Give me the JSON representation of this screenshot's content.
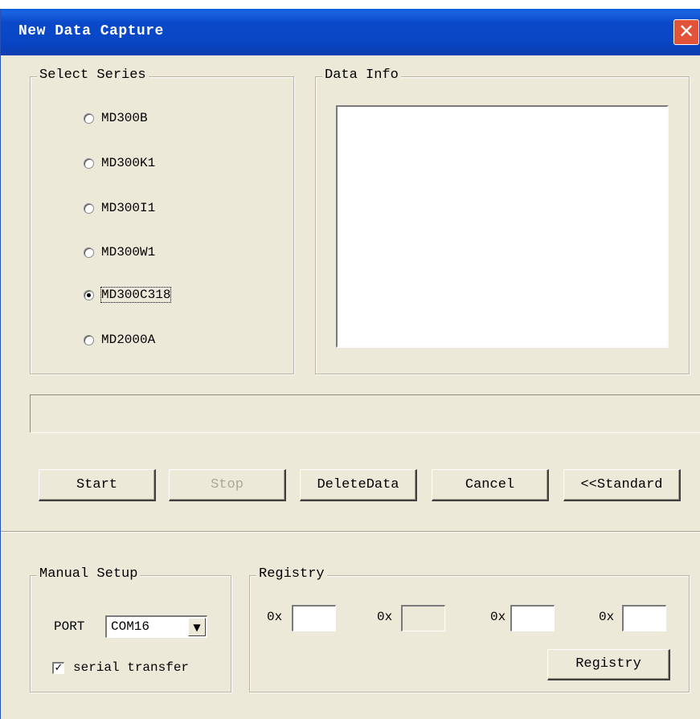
{
  "window": {
    "title": "New Data Capture",
    "close_glyph": "✕"
  },
  "select_series": {
    "legend": "Select Series",
    "options": [
      {
        "label": "MD300B",
        "selected": false
      },
      {
        "label": "MD300K1",
        "selected": false
      },
      {
        "label": "MD300I1",
        "selected": false
      },
      {
        "label": "MD300W1",
        "selected": false
      },
      {
        "label": "MD300C318",
        "selected": true
      },
      {
        "label": "MD2000A",
        "selected": false
      }
    ]
  },
  "data_info": {
    "legend": "Data Info",
    "content": ""
  },
  "buttons": {
    "start": "Start",
    "stop": "Stop",
    "delete_data": "DeleteData",
    "cancel": "Cancel",
    "standard": "<<Standard"
  },
  "manual_setup": {
    "legend": "Manual Setup",
    "port_label": "PORT",
    "port_value": "COM16",
    "dropdown_glyph": "▼",
    "serial_label": "serial transfer",
    "serial_checked": true,
    "check_glyph": "✓"
  },
  "registry": {
    "legend": "Registry",
    "prefix": "0x",
    "fields": [
      "",
      "",
      "",
      ""
    ],
    "button": "Registry"
  }
}
